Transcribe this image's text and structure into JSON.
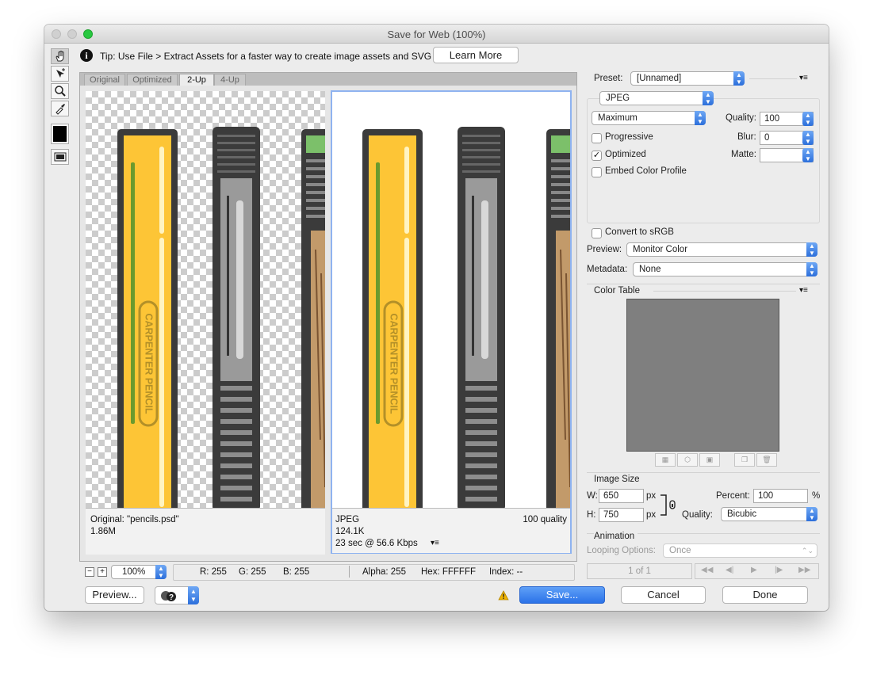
{
  "window": {
    "title": "Save for Web (100%)"
  },
  "tip": {
    "text": "Tip: Use File > Extract Assets for a faster way to create image assets and SVG",
    "learn_more": "Learn More"
  },
  "tabs": [
    "Original",
    "Optimized",
    "2-Up",
    "4-Up"
  ],
  "pencil_text": "CARPENTER PENCIL",
  "left_pane": {
    "name": "Original: \"pencils.psd\"",
    "size": "1.86M"
  },
  "right_pane": {
    "format": "JPEG",
    "size": "124.1K",
    "speed": "23 sec @ 56.6 Kbps",
    "quality": "100 quality"
  },
  "bottom": {
    "zoom": "100%",
    "r": "R: 255",
    "g": "G: 255",
    "b": "B: 255",
    "alpha": "Alpha: 255",
    "hex": "Hex: FFFFFF",
    "index": "Index: --"
  },
  "footer": {
    "preview": "Preview...",
    "save": "Save...",
    "cancel": "Cancel",
    "done": "Done"
  },
  "settings": {
    "preset_label": "Preset:",
    "preset_value": "[Unnamed]",
    "format": "JPEG",
    "quality_preset": "Maximum",
    "quality_label": "Quality:",
    "quality_value": "100",
    "progressive": "Progressive",
    "blur_label": "Blur:",
    "blur_value": "0",
    "optimized": "Optimized",
    "matte_label": "Matte:",
    "embed": "Embed Color Profile",
    "convert": "Convert to sRGB",
    "preview_label": "Preview:",
    "preview_value": "Monitor Color",
    "metadata_label": "Metadata:",
    "metadata_value": "None",
    "color_table": "Color Table",
    "image_size": "Image Size",
    "w_label": "W:",
    "w_value": "650",
    "h_label": "H:",
    "h_value": "750",
    "px": "px",
    "percent_label": "Percent:",
    "percent_value": "100",
    "percent_unit": "%",
    "resample_label": "Quality:",
    "resample_value": "Bicubic",
    "animation": "Animation",
    "looping_label": "Looping Options:",
    "looping_value": "Once",
    "frame": "1 of 1"
  },
  "colors": {
    "accent": "#2e7cf6",
    "pencil_yellow": "#fdc536",
    "pencil_dark": "#3b3b3b",
    "warning": "#f0b400"
  }
}
